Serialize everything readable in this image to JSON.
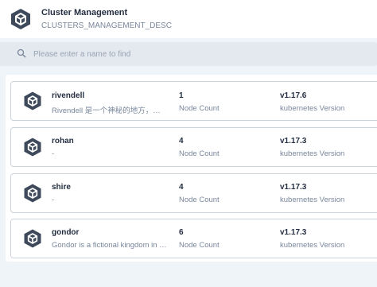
{
  "header": {
    "title": "Cluster Management",
    "description": "CLUSTERS_MANAGEMENT_DESC"
  },
  "search": {
    "placeholder": "Please enter a name to find"
  },
  "clusters": [
    {
      "name": "rivendell",
      "description": "Rivendell 是一个神秘的地方，…",
      "node_count": "1",
      "node_count_label": "Node Count",
      "version": "v1.17.6",
      "version_label": "kubernetes Version"
    },
    {
      "name": "rohan",
      "description": "-",
      "node_count": "4",
      "node_count_label": "Node Count",
      "version": "v1.17.3",
      "version_label": "kubernetes Version"
    },
    {
      "name": "shire",
      "description": "-",
      "node_count": "4",
      "node_count_label": "Node Count",
      "version": "v1.17.3",
      "version_label": "kubernetes Version"
    },
    {
      "name": "gondor",
      "description": "Gondor is a fictional kingdom in …",
      "node_count": "6",
      "node_count_label": "Node Count",
      "version": "v1.17.3",
      "version_label": "kubernetes Version"
    }
  ]
}
